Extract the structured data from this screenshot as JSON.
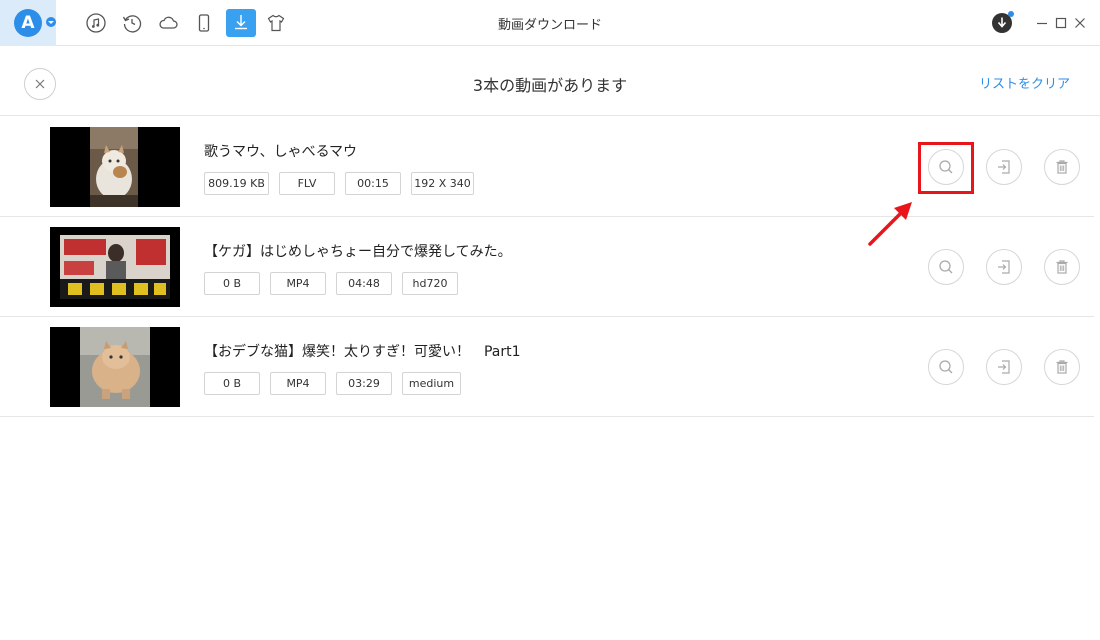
{
  "app": {
    "logo_letter": "A",
    "window_title": "動画ダウンロード",
    "nav_icons": [
      "music-icon",
      "history-icon",
      "cloud-icon",
      "phone-icon",
      "download-icon",
      "tshirt-icon"
    ],
    "accent": "#2c8ee8"
  },
  "header": {
    "title": "3本の動画があります",
    "clear_label": "リストをクリア"
  },
  "videos": [
    {
      "title": "歌うマウ、しゃべるマウ",
      "size": "809.19 KB",
      "format": "FLV",
      "duration": "00:15",
      "quality": "192 X 340"
    },
    {
      "title": "【ケガ】はじめしゃちょー自分で爆発してみた。",
      "size": "0 B",
      "format": "MP4",
      "duration": "04:48",
      "quality": "hd720"
    },
    {
      "title": "【おデブな猫】爆笑！太りすぎ！可愛い！　Part1",
      "size": "0 B",
      "format": "MP4",
      "duration": "03:29",
      "quality": "medium"
    }
  ],
  "colors": {
    "highlight": "#e8161b",
    "divider": "#e6e6e6"
  }
}
